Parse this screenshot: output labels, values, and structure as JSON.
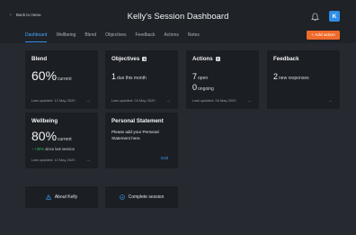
{
  "header": {
    "back_label": "Back to menu",
    "title": "Kelly's Session Dashboard",
    "avatar_initial": "K"
  },
  "tabs": [
    {
      "label": "Dashboard",
      "active": true
    },
    {
      "label": "Wellbeing",
      "active": false
    },
    {
      "label": "Blend",
      "active": false
    },
    {
      "label": "Objectives",
      "active": false
    },
    {
      "label": "Feedback",
      "active": false
    },
    {
      "label": "Actions",
      "active": false
    },
    {
      "label": "Notes",
      "active": false
    }
  ],
  "add_action_label": "+ Add action",
  "cards": {
    "blend": {
      "title": "Blend",
      "value": "60%",
      "suffix": "current",
      "updated": "Last updated: 12 May 2020"
    },
    "objectives": {
      "title": "Objectives",
      "badge": "3",
      "value": "1",
      "suffix": "due this month",
      "updated": "Last updated: 04 May 2020"
    },
    "actions": {
      "title": "Actions",
      "badge": "7",
      "open_value": "7",
      "open_label": "open",
      "ongoing_value": "0",
      "ongoing_label": "ongoing",
      "updated": "Last updated: 06 May 2020"
    },
    "feedback": {
      "title": "Feedback",
      "value": "2",
      "suffix": "new responses"
    },
    "wellbeing": {
      "title": "Wellbeing",
      "value": "80%",
      "suffix": "current",
      "trend": "+30%",
      "trend_label": "since last session",
      "updated": "Last updated: 12 May 2020"
    },
    "personal_statement": {
      "title": "Personal Statement",
      "text": "Please add your Personal Statement here.",
      "edit_label": "Edit"
    }
  },
  "bottom_buttons": {
    "about": "About Kelly",
    "complete": "Complete session"
  },
  "colors": {
    "accent": "#2e8ee6",
    "add_button": "#f06a2a",
    "positive": "#3dba6a"
  },
  "icons": {
    "back": "back-arrow-icon",
    "bell": "bell-icon",
    "arrow": "arrow-right-icon",
    "about": "warning-icon",
    "complete": "check-circle-icon"
  }
}
